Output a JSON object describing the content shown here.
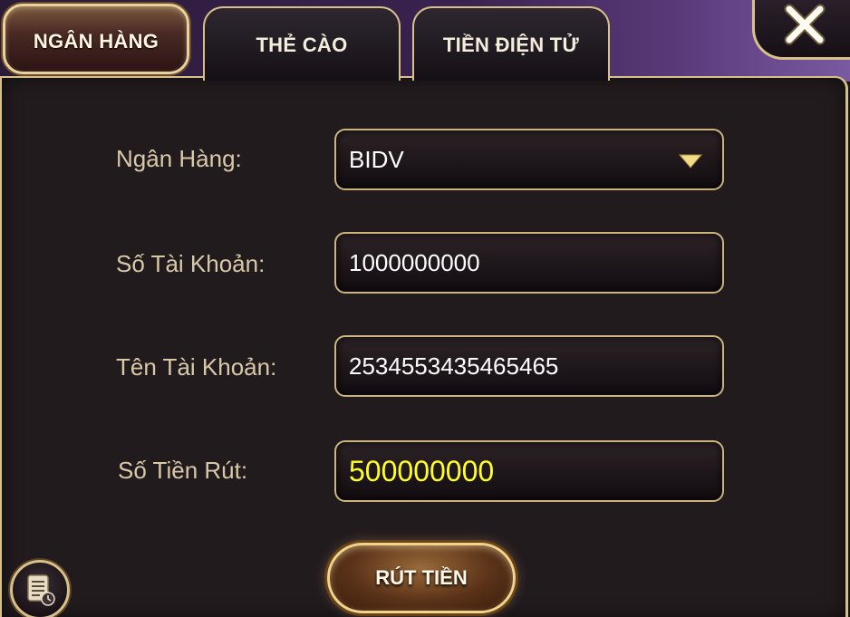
{
  "tabs": [
    {
      "label": "NGÂN HÀNG",
      "active": true
    },
    {
      "label": "THẺ CÀO",
      "active": false
    },
    {
      "label": "TIỀN ĐIỆN TỬ",
      "active": false
    }
  ],
  "close": {
    "icon": "close-icon"
  },
  "form": {
    "bank": {
      "label": "Ngân Hàng:",
      "value": "BIDV"
    },
    "account_number": {
      "label": "Số Tài Khoản:",
      "value": "1000000000"
    },
    "account_name": {
      "label": "Tên Tài Khoản:",
      "value": "2534553435465465"
    },
    "amount": {
      "label": "Số Tiền Rút:",
      "value": "500000000"
    }
  },
  "submit_label": "RÚT TIỀN",
  "history": {
    "icon": "history-icon"
  },
  "colors": {
    "accent_gold": "#d8c08a",
    "amount_text": "#ffff22",
    "label_text": "#d8c9a8",
    "panel_bg": "#221b1e"
  }
}
